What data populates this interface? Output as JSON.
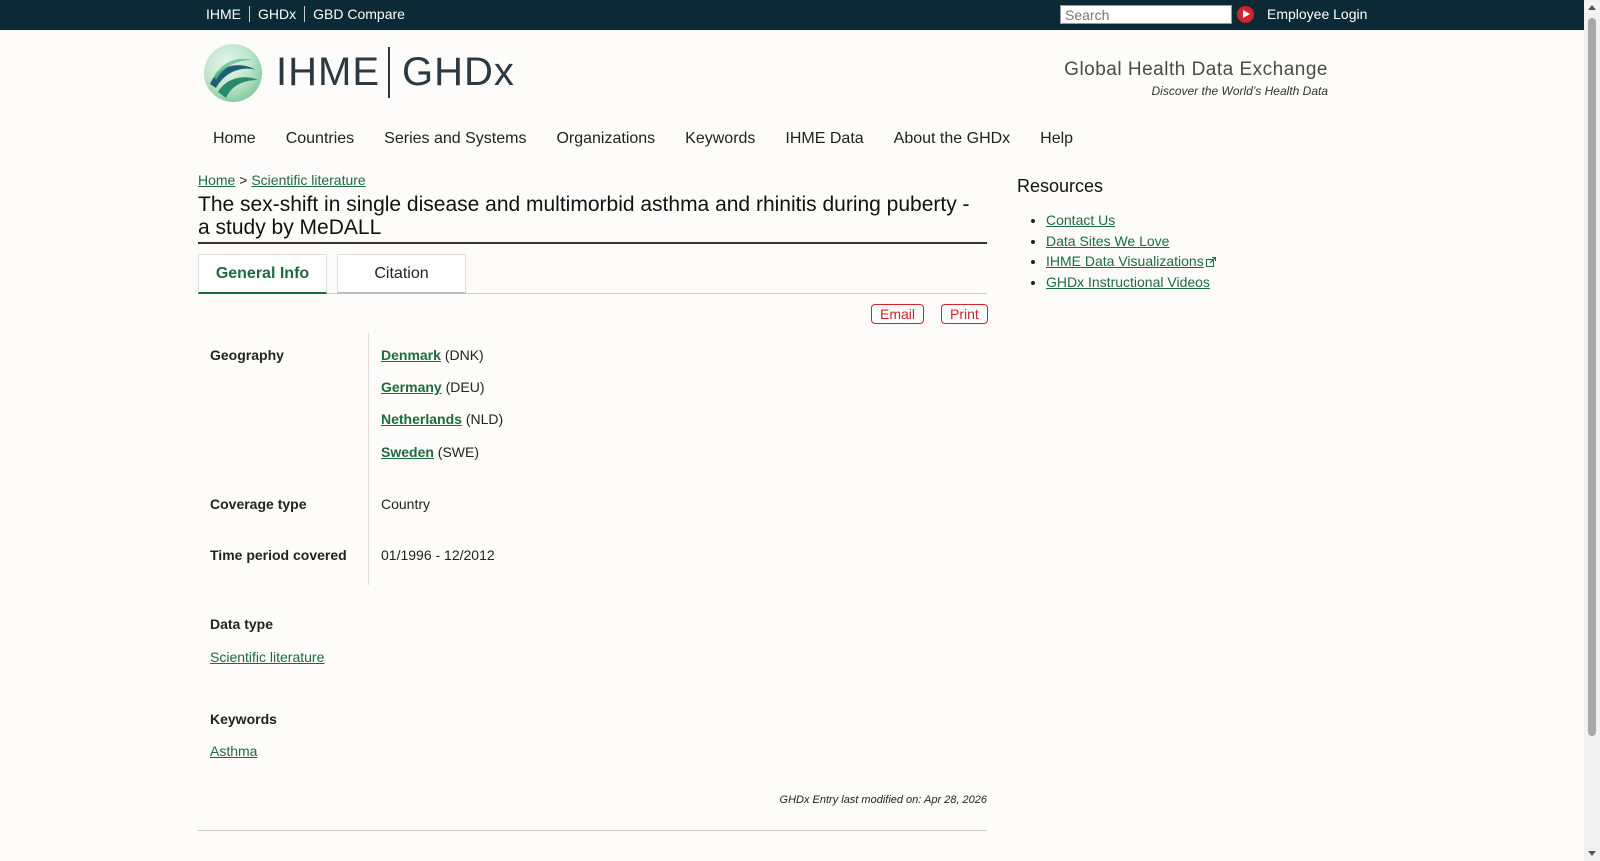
{
  "topbar": {
    "links": [
      "IHME",
      "GHDx",
      "GBD Compare"
    ],
    "search_placeholder": "Search",
    "login": "Employee Login"
  },
  "header": {
    "logo_ihme": "IHME",
    "logo_ghdx": "GHDx",
    "tagline_title": "Global Health Data Exchange",
    "tagline_sub": "Discover the World’s Health Data"
  },
  "nav": [
    "Home",
    "Countries",
    "Series and Systems",
    "Organizations",
    "Keywords",
    "IHME Data",
    "About the GHDx",
    "Help"
  ],
  "breadcrumb": {
    "home": "Home",
    "sep": ">",
    "current": "Scientific literature"
  },
  "page_title": "The sex-shift in single disease and multimorbid asthma and rhinitis during puberty - a study by MeDALL",
  "tabs": [
    "General Info",
    "Citation"
  ],
  "actions": {
    "email": "Email",
    "print": "Print"
  },
  "info": {
    "geography_label": "Geography",
    "geography": [
      {
        "name": "Denmark",
        "code": "(DNK)"
      },
      {
        "name": "Germany",
        "code": "(DEU)"
      },
      {
        "name": "Netherlands",
        "code": "(NLD)"
      },
      {
        "name": "Sweden",
        "code": "(SWE)"
      }
    ],
    "coverage_label": "Coverage type",
    "coverage": "Country",
    "period_label": "Time period covered",
    "period": "01/1996 - 12/2012",
    "datatype_label": "Data type",
    "datatype": "Scientific literature",
    "keywords_label": "Keywords",
    "keyword": "Asthma",
    "modified": "GHDx Entry last modified on: Apr 28, 2026"
  },
  "resources": {
    "title": "Resources",
    "items": [
      "Contact Us",
      "Data Sites We Love",
      "IHME Data Visualizations",
      "GHDx Instructional Videos"
    ]
  },
  "colors": {
    "topbar": "#0c2a35",
    "link": "#1d6b3c",
    "accent_red": "#d0232a"
  }
}
